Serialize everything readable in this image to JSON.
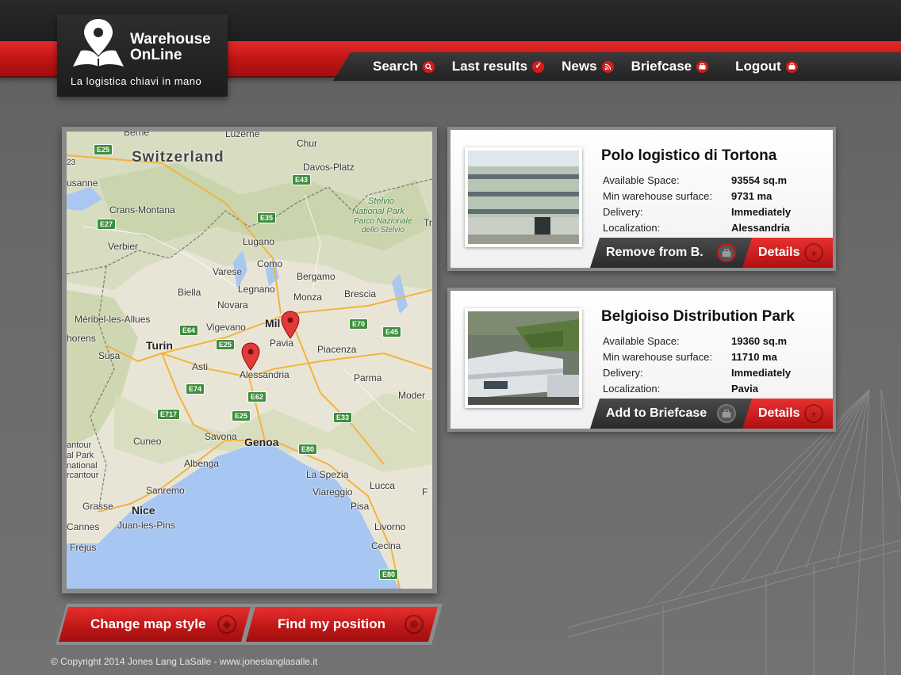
{
  "brand": {
    "name_line1": "Warehouse",
    "name_line2": "OnLine",
    "tagline": "La logistica chiavi in mano"
  },
  "nav": {
    "items": [
      {
        "label": "Search",
        "icon": "search-icon"
      },
      {
        "label": "Last results",
        "icon": "check-icon"
      },
      {
        "label": "News",
        "icon": "rss-icon"
      },
      {
        "label": "Briefcase",
        "icon": "briefcase-icon"
      },
      {
        "label": "Logout",
        "icon": "briefcase-icon"
      }
    ]
  },
  "map": {
    "labels": {
      "switzerland": "Switzerland",
      "berne": "Berne",
      "chur": "Chur",
      "luzerne": "Luzerne",
      "davos": "Davos-Platz",
      "usanne": "usanne",
      "crans": "Crans-Montana",
      "stelvio1": "Stelvio",
      "stelvio2": "National Park",
      "stelvio3": "Parco Nazionale",
      "stelvio4": "dello Stelvio",
      "verbier": "Verbier",
      "lugano": "Lugano",
      "como": "Como",
      "varese": "Varese",
      "bergamo": "Bergamo",
      "biella": "Biella",
      "legnano": "Legnano",
      "monza": "Monza",
      "brescia": "Brescia",
      "novara": "Novara",
      "meribel": "Méribel-les-Allues",
      "vigevano": "Vigevano",
      "milan": "Mil",
      "thorens": "horens",
      "turin": "Turin",
      "pavia": "Pavia",
      "piacenza": "Piacenza",
      "susa": "Susa",
      "asti": "Asti",
      "alessandria": "Alessandria",
      "parma": "Parma",
      "modena": "Moder",
      "cuneo": "Cuneo",
      "savona": "Savona",
      "genoa": "Genoa",
      "ntour1": "antour",
      "ntour2": "al Park",
      "ntour3": "national",
      "ntour4": "rcantour",
      "albenga": "Albenga",
      "laspezia": "La Spezia",
      "sanremo": "Sanremo",
      "viareggio": "Viareggio",
      "lucca": "Lucca",
      "grasse": "Grasse",
      "nice": "Nice",
      "pisa": "Pisa",
      "cannes": "Cannes",
      "juan": "Juan-les-Pins",
      "livorno": "Livorno",
      "frejus": "Fréjus",
      "cecina": "Cecina",
      "tr": "Tr",
      "f": "F",
      "tz23": "23"
    },
    "roads": [
      "E25",
      "E43",
      "E35",
      "E27",
      "E70",
      "E45",
      "E64",
      "E25",
      "E74",
      "E62",
      "E717",
      "E25",
      "E33",
      "E80",
      "E80"
    ],
    "pins": [
      "map-pin-tortona",
      "map-pin-pavia"
    ]
  },
  "map_buttons": {
    "change_style": "Change map style",
    "find_position": "Find my position"
  },
  "listings": [
    {
      "title": "Polo logistico di Tortona",
      "fields": [
        {
          "label": "Available Space:",
          "value": "93554 sq.m"
        },
        {
          "label": "Min warehouse surface:",
          "value": "9731 ma"
        },
        {
          "label": "Delivery:",
          "value": "Immediately"
        },
        {
          "label": "Localization:",
          "value": "Alessandria"
        }
      ],
      "briefcase_action": "Remove from B.",
      "details_action": "Details"
    },
    {
      "title": "Belgioiso Distribution Park",
      "fields": [
        {
          "label": "Available Space:",
          "value": "19360 sq.m"
        },
        {
          "label": "Min warehouse surface:",
          "value": "11710 ma"
        },
        {
          "label": "Delivery:",
          "value": "Immediately"
        },
        {
          "label": "Localization:",
          "value": "Pavia"
        }
      ],
      "briefcase_action": "Add to Briefcase",
      "details_action": "Details"
    }
  ],
  "footer": {
    "copyright": "© Copyright 2014 Jones Lang LaSalle - www.joneslanglasalle.it"
  },
  "colors": {
    "accent_red": "#d41c1c",
    "header_dark": "#1e1e1e",
    "background": "#666666"
  }
}
